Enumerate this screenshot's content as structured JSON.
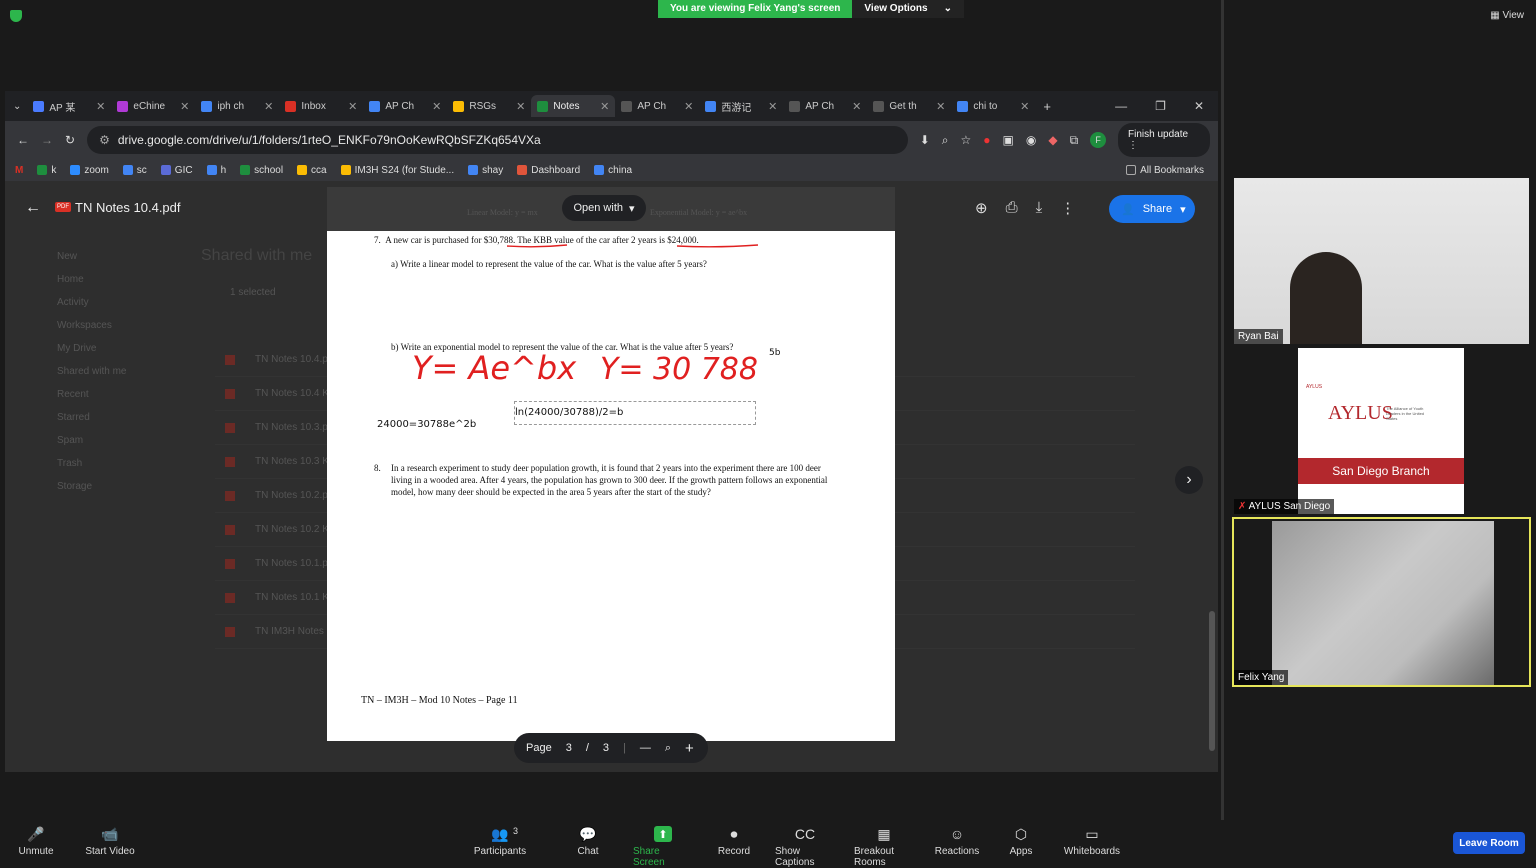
{
  "zoom": {
    "banner": "You are viewing Felix Yang's screen",
    "view_options": "View Options",
    "view": "View",
    "participants_count": "3",
    "leave": "Leave Room",
    "toolbar": [
      {
        "label": "Unmute",
        "icon": "mic-muted-icon"
      },
      {
        "label": "Start Video",
        "icon": "video-off-icon"
      },
      {
        "label": "Participants",
        "icon": "participants-icon"
      },
      {
        "label": "Chat",
        "icon": "chat-icon"
      },
      {
        "label": "Share Screen",
        "icon": "share-screen-icon"
      },
      {
        "label": "Record",
        "icon": "record-icon"
      },
      {
        "label": "Show Captions",
        "icon": "captions-icon"
      },
      {
        "label": "Breakout Rooms",
        "icon": "breakout-icon"
      },
      {
        "label": "Reactions",
        "icon": "reactions-icon"
      },
      {
        "label": "Apps",
        "icon": "apps-icon"
      },
      {
        "label": "Whiteboards",
        "icon": "whiteboard-icon"
      }
    ],
    "participants": [
      {
        "name": "Ryan Bai"
      },
      {
        "name": "AYLUS San Diego"
      },
      {
        "name": "Felix Yang"
      }
    ],
    "aylus": {
      "logo": "AYLUS",
      "tagline": "The Alliance of Youth Leaders in the United States",
      "branch": "San Diego Branch",
      "small": "AYLUS"
    }
  },
  "browser": {
    "tabs": [
      {
        "label": "AP 某",
        "color": "#4a7bff"
      },
      {
        "label": "eChine",
        "color": "#b03ad6"
      },
      {
        "label": "iph ch",
        "color": "#4285f4"
      },
      {
        "label": "Inbox",
        "color": "#d93025"
      },
      {
        "label": "AP Ch",
        "color": "#4285f4"
      },
      {
        "label": "RSGs",
        "color": "#fbbc04"
      },
      {
        "label": "Notes",
        "color": "#1e8e3e"
      },
      {
        "label": "AP Ch",
        "color": "#555"
      },
      {
        "label": "西游记",
        "color": "#4285f4"
      },
      {
        "label": "AP Ch",
        "color": "#555"
      },
      {
        "label": "Get th",
        "color": "#555"
      },
      {
        "label": "chi to",
        "color": "#4285f4"
      }
    ],
    "url": "drive.google.com/drive/u/1/folders/1rteO_ENKFo79nOoKewRQbSFZKq654VXa",
    "finish_update": "Finish update",
    "bookmarks": [
      "k",
      "zoom",
      "sc",
      "GIC",
      "h",
      "school",
      "cca",
      "IM3H S24 (for Stude...",
      "shay",
      "Dashboard",
      "china"
    ],
    "all_bookmarks": "All Bookmarks"
  },
  "drive": {
    "file_title": "TN Notes 10.4.pdf",
    "share": "Share",
    "open_with": "Open with",
    "header_left": "Linear Model: y = mx",
    "header_right": "Exponential Model: y = ae^bx",
    "bg_rows": [
      "TN Notes 10.4.pdf",
      "TN Notes 10.4 Key",
      "TN Notes 10.3.pdf",
      "TN Notes 10.3 Key",
      "TN Notes 10.2.pdf",
      "TN Notes 10.2 Key",
      "TN Notes 10.1.pdf",
      "TN Notes 10.1 Key",
      "TN IM3H Notes 10"
    ],
    "bg_nav": [
      "New",
      "Home",
      "Activity",
      "Workspaces",
      "My Drive",
      "Shared with me",
      "Recent",
      "Starred",
      "Spam",
      "Trash",
      "Storage"
    ],
    "bg_heading": "Shared with me",
    "selected": "1 selected"
  },
  "pdf": {
    "q7_num": "7.",
    "q7": "A new car is purchased for $30,788. The KBB value of the car after 2 years is $24,000.",
    "q7a": "a) Write a linear model to represent the value of the car. What is the value after 5 years?",
    "q7b": "b) Write an exponential model to represent the value of the car. What is the value after 5 years?",
    "handwriting_1": "Y= Ae^bx",
    "handwriting_2": "Y= 30 788",
    "sup_5b": "5b",
    "eq1": "24000=30788e^2b",
    "eq2": "ln(24000/30788)/2=b",
    "q8_num": "8.",
    "q8": "In a research experiment to study deer population growth, it is found that 2 years into the experiment there are 100 deer living in a wooded area. After 4 years, the population has grown to 300 deer. If the growth pattern follows an exponential model, how many deer should be expected in the area 5 years after the start of the study?",
    "footer": "TN – IM3H – Mod 10 Notes – Page 11",
    "page_label": "Page",
    "page_current": "3",
    "page_sep": "/",
    "page_total": "3"
  }
}
